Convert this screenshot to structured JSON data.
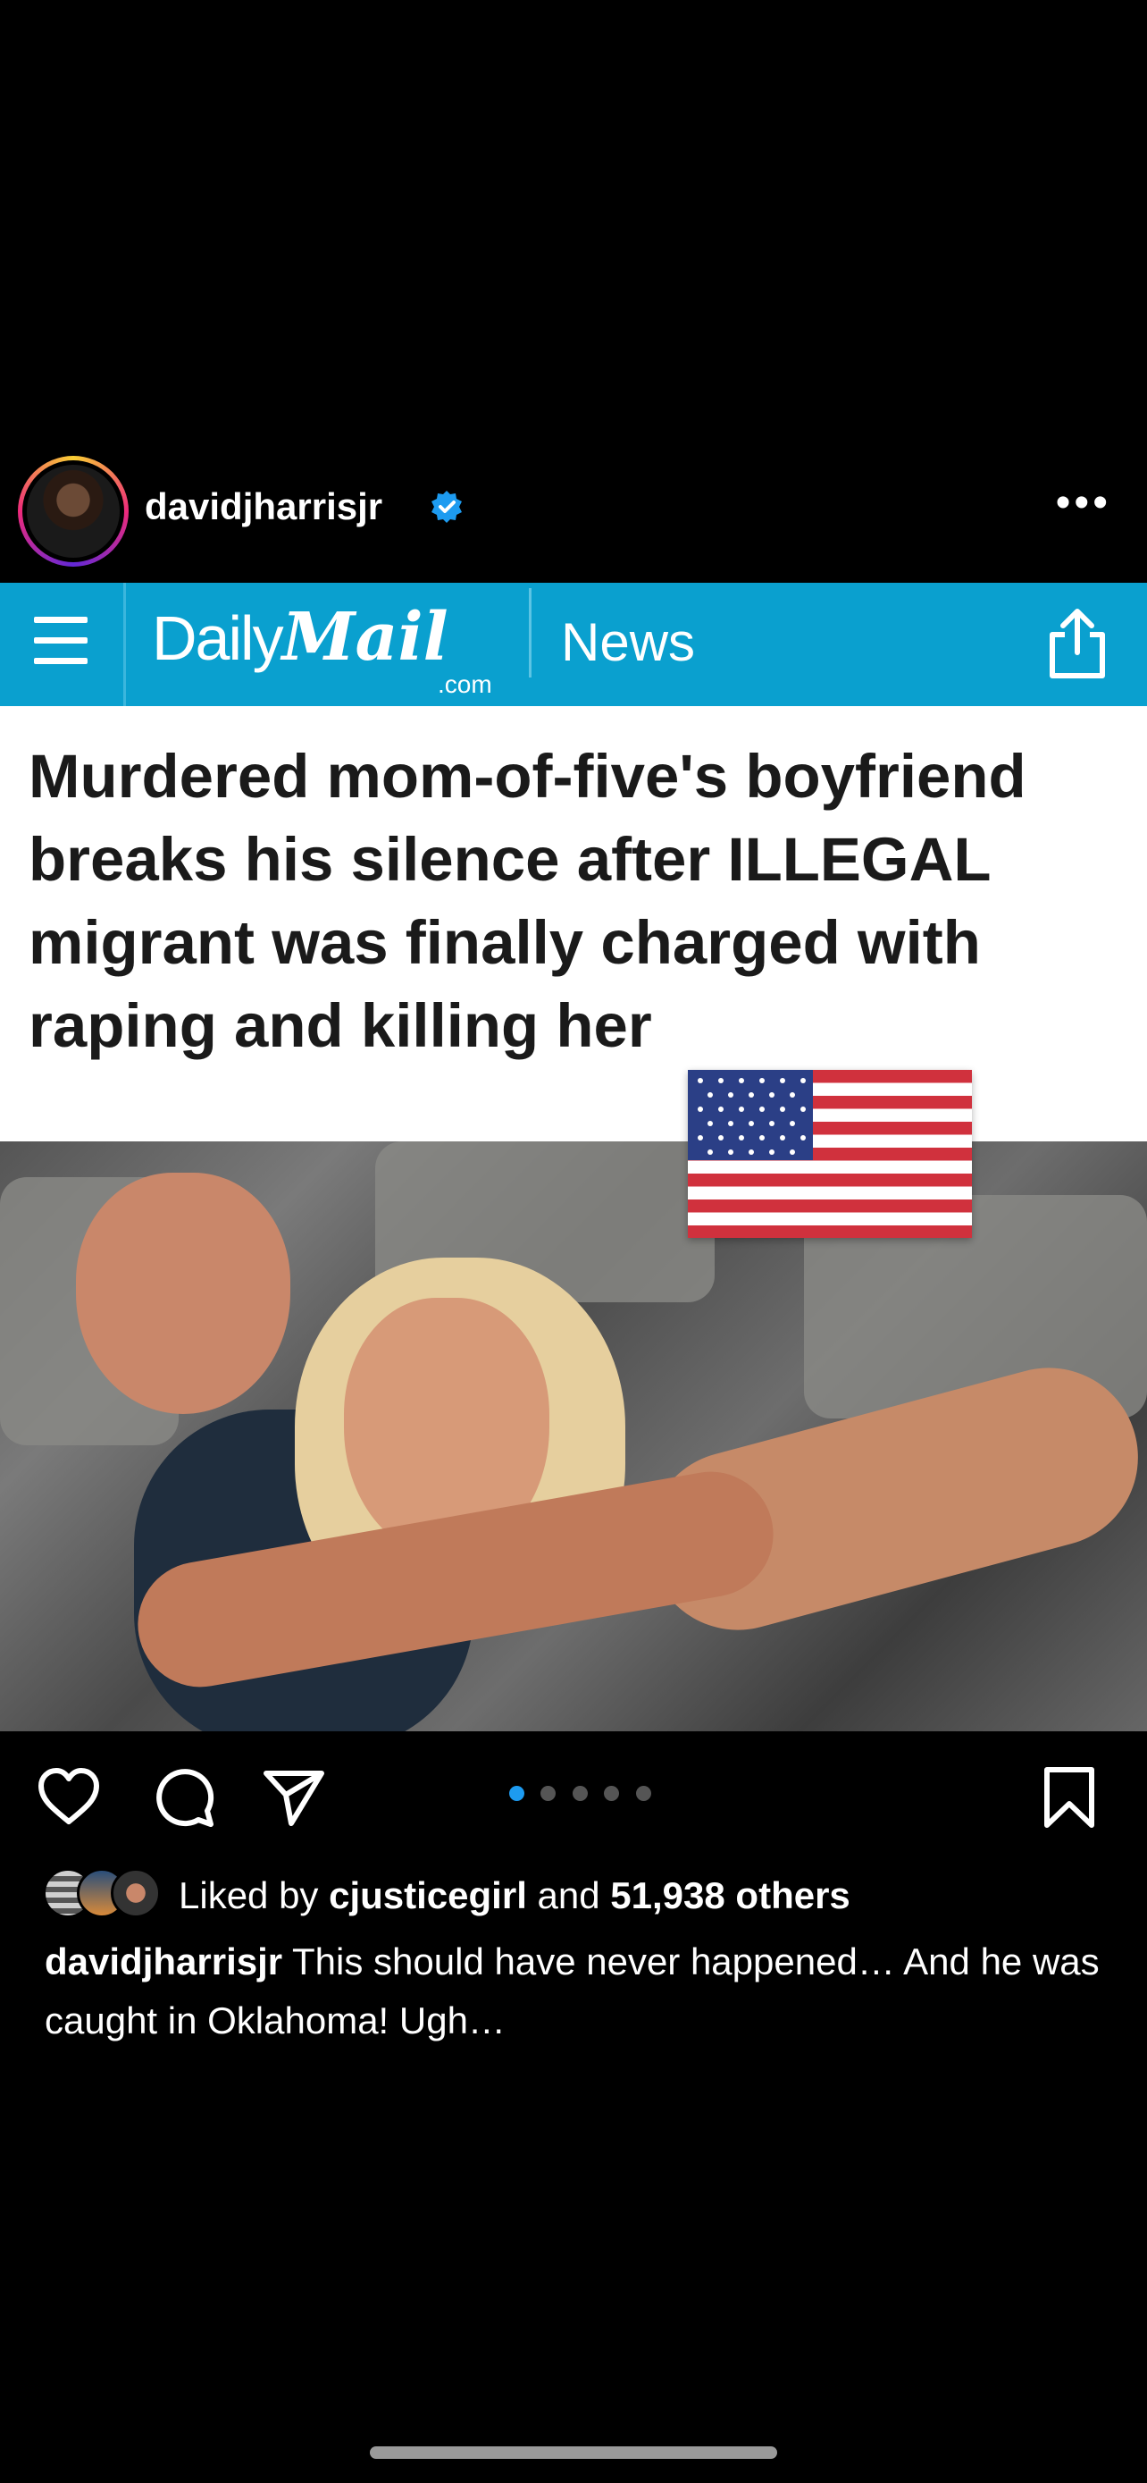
{
  "post": {
    "username": "davidjharrisjr",
    "verified_icon": "verified-badge-icon",
    "more_icon": "more-options-icon"
  },
  "daily_mail": {
    "logo_daily": "Daily",
    "logo_mail": "Mail",
    "logo_com": ".com",
    "section": "News",
    "brand_color": "#0aa0cf",
    "menu_icon": "hamburger-menu-icon",
    "share_icon": "share-icon"
  },
  "headline": "Murdered mom-of-five's boyfriend breaks his silence after ILLEGAL migrant was finally charged with raping and killing her",
  "actions": {
    "icons": [
      "heart-icon",
      "comment-icon",
      "send-icon",
      "bookmark-icon"
    ],
    "carousel": {
      "total": 5,
      "active": 1
    }
  },
  "likes": {
    "prefix": "Liked by",
    "user": "cjusticegirl",
    "middle": "and",
    "others": "51,938 others"
  },
  "caption": {
    "username": "davidjharrisjr",
    "text": "This should have never happened… And he was caught in Oklahoma! Ugh…"
  },
  "colors": {
    "accent": "#1d9bf0",
    "background": "#000000"
  }
}
